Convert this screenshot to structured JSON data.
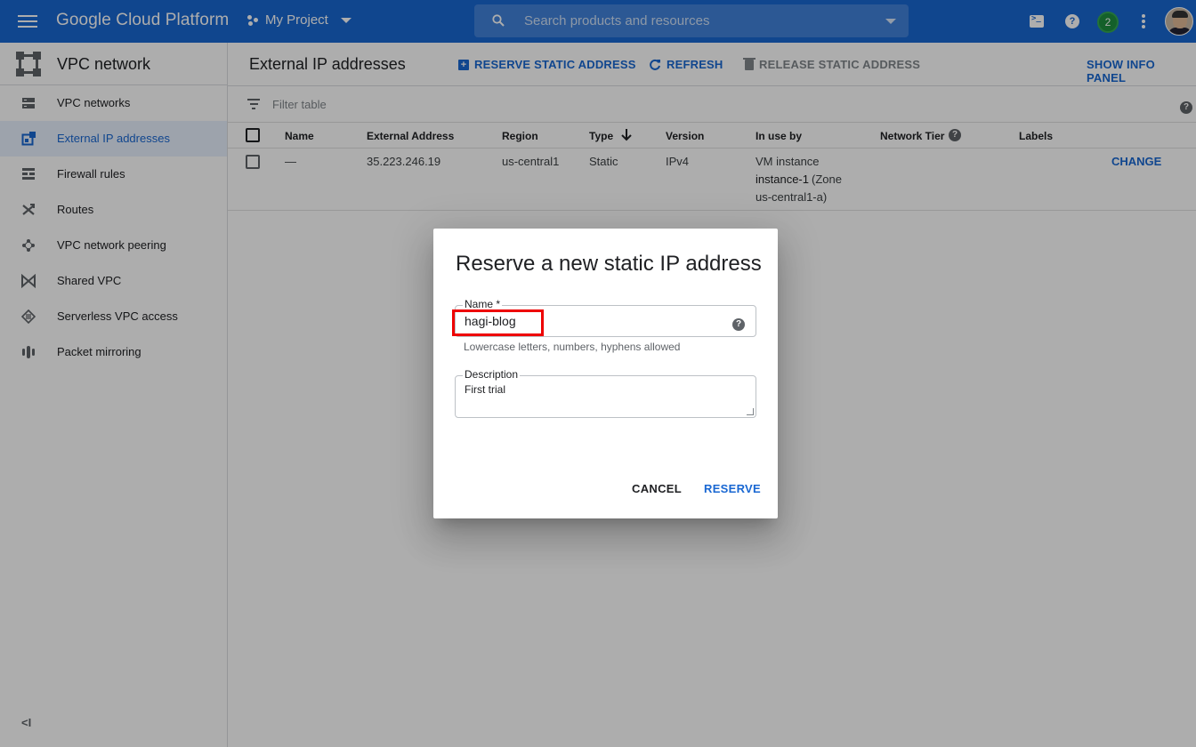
{
  "topbar": {
    "brand": "Google Cloud Platform",
    "project": "My Project",
    "search_placeholder": "Search products and resources",
    "notification_count": "2",
    "icons": [
      "menu-icon",
      "cloud-shell-icon",
      "help-icon",
      "notifications-icon",
      "more-vert-icon",
      "account-avatar"
    ]
  },
  "sidebar": {
    "title": "VPC network",
    "items": [
      {
        "label": "VPC networks",
        "icon": "vpc-networks-icon",
        "active": false
      },
      {
        "label": "External IP addresses",
        "icon": "external-ip-icon",
        "active": true
      },
      {
        "label": "Firewall rules",
        "icon": "firewall-icon",
        "active": false
      },
      {
        "label": "Routes",
        "icon": "routes-icon",
        "active": false
      },
      {
        "label": "VPC network peering",
        "icon": "peering-icon",
        "active": false
      },
      {
        "label": "Shared VPC",
        "icon": "shared-vpc-icon",
        "active": false
      },
      {
        "label": "Serverless VPC access",
        "icon": "serverless-icon",
        "active": false
      },
      {
        "label": "Packet mirroring",
        "icon": "packet-mirroring-icon",
        "active": false
      }
    ],
    "collapse_label": "<I"
  },
  "main": {
    "title": "External IP addresses",
    "actions": {
      "reserve": "RESERVE STATIC ADDRESS",
      "refresh": "REFRESH",
      "release": "RELEASE STATIC ADDRESS",
      "info_panel": "SHOW INFO PANEL"
    },
    "filter_placeholder": "Filter table",
    "table": {
      "headers": [
        "Name",
        "External Address",
        "Region",
        "Type",
        "Version",
        "In use by",
        "Network Tier",
        "Labels"
      ],
      "sort_column": "Type",
      "rows": [
        {
          "name": "—",
          "address": "35.223.246.19",
          "region": "us-central1",
          "type": "Static",
          "version": "IPv4",
          "in_use_line1": "VM instance",
          "in_use_instance": "instance-1",
          "in_use_zone": " (Zone",
          "in_use_line3": "us-central1-a)",
          "network_tier": "",
          "labels": "",
          "action": "CHANGE"
        }
      ]
    }
  },
  "dialog": {
    "title": "Reserve a new static IP address",
    "name_label": "Name *",
    "name_value": "hagi-blog",
    "name_hint": "Lowercase letters, numbers, hyphens allowed",
    "description_label": "Description",
    "description_value": "First trial",
    "cancel": "CANCEL",
    "reserve": "RESERVE"
  },
  "colors": {
    "topbar": "#1967d2",
    "accent": "#1967d2",
    "active_nav_bg": "#e8f0fe",
    "highlight": "#ee0000",
    "overlay": "rgba(0,0,0,0.32)"
  }
}
